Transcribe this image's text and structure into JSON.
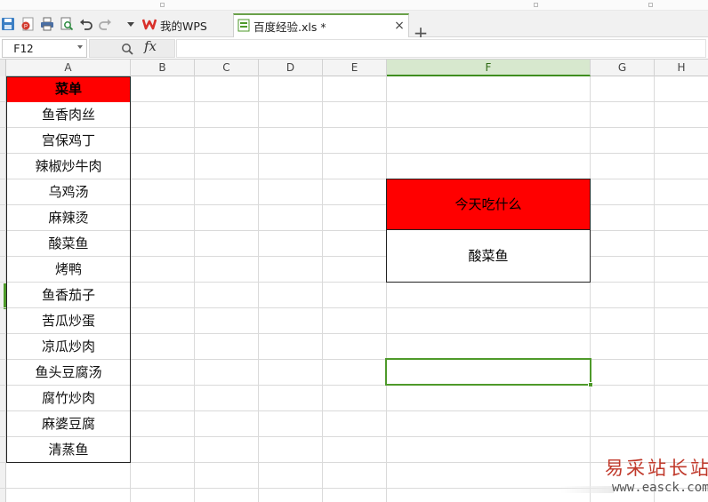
{
  "tabs": [
    {
      "label": "我的WPS"
    },
    {
      "label": "百度经验.xls *",
      "active": true
    }
  ],
  "toolbar_icons": [
    "save-icon",
    "export-pdf-icon",
    "print-icon",
    "print-preview-icon",
    "undo-icon",
    "redo-icon",
    "more-dropdown-icon"
  ],
  "formula_bar": {
    "name_box": "F12",
    "fx_label": "fx",
    "formula": ""
  },
  "columns": [
    "A",
    "B",
    "C",
    "D",
    "E",
    "F",
    "G",
    "H"
  ],
  "selected_column": "F",
  "selected_cell": "F12",
  "menu": {
    "header": "菜单",
    "items": [
      "鱼香肉丝",
      "宫保鸡丁",
      "辣椒炒牛肉",
      "乌鸡汤",
      "麻辣烫",
      "酸菜鱼",
      "烤鸭",
      "鱼香茄子",
      "苦瓜炒蛋",
      "凉瓜炒肉",
      "鱼头豆腐汤",
      "腐竹炒肉",
      "麻婆豆腐",
      "清蒸鱼"
    ]
  },
  "question": "今天吃什么",
  "answer": "酸菜鱼",
  "colors": {
    "header_fill": "#ff0000",
    "selection": "#4e9a2a",
    "active_tab_accent": "#6aa14a"
  },
  "watermark": {
    "cn": "易采站长站",
    "en": "www.easck.com"
  }
}
